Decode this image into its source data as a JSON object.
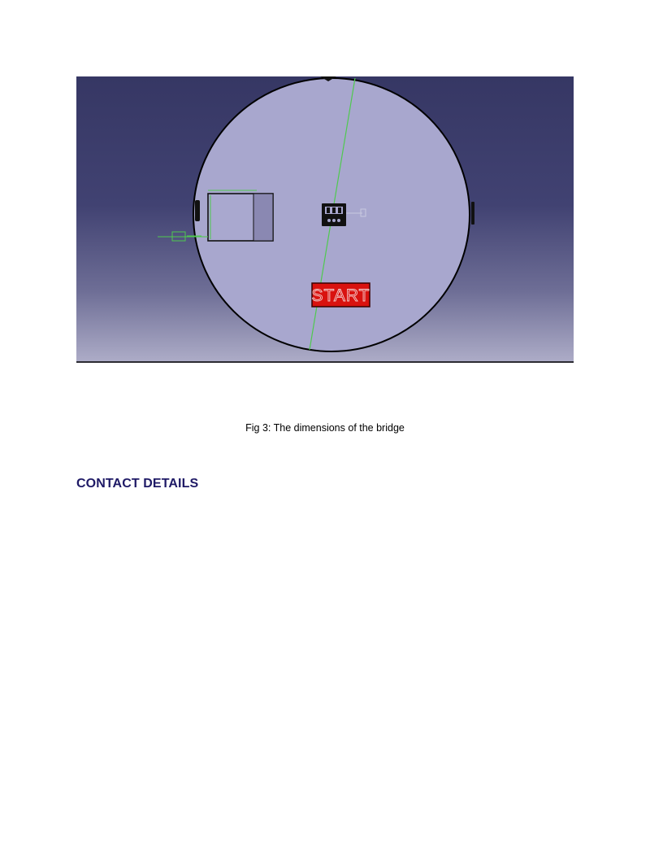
{
  "figure": {
    "start_label": "START",
    "background_top_color": "#383a66",
    "background_bottom_color": "#a9a8c6",
    "plate_color": "#a8a7ce",
    "start_button_color": "#d9120f",
    "dimension_line_color": "#4fc94f"
  },
  "caption": "Fig 3: The dimensions of the bridge",
  "section_heading": "CONTACT DETAILS"
}
